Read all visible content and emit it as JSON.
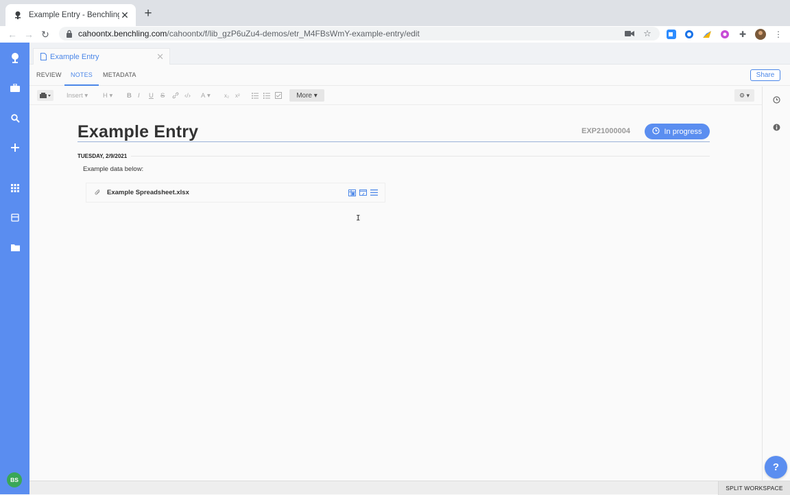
{
  "browser": {
    "tab_title": "Example Entry - Benchling",
    "new_tab_symbol": "+",
    "url_host": "cahoontx.benchling.com",
    "url_path": "/cahoontx/f/lib_gzP6uZu4-demos/etr_M4FBsWmY-example-entry/edit"
  },
  "app": {
    "accent": "#5a8df0",
    "user_initials": "BS",
    "sidebar_items": [
      "benchling-logo",
      "briefcase",
      "search",
      "create",
      "apps",
      "inventory",
      "projects"
    ]
  },
  "doc_tab": {
    "label": "Example Entry"
  },
  "view_tabs": {
    "review": "REVIEW",
    "notes": "NOTES",
    "metadata": "METADATA",
    "share": "Share"
  },
  "format_toolbar": {
    "insert": "Insert",
    "heading": "H",
    "bold": "B",
    "italic": "I",
    "underline": "U",
    "strike": "S",
    "font_color": "A",
    "more": "More"
  },
  "entry": {
    "title": "Example Entry",
    "id": "EXP21000004",
    "status": "In progress",
    "date": "TUESDAY, 2/9/2021",
    "note": "Example data below:",
    "attachment_name": "Example Spreadsheet.xlsx"
  },
  "footer": {
    "split_workspace": "SPLIT WORKSPACE",
    "help": "?"
  }
}
